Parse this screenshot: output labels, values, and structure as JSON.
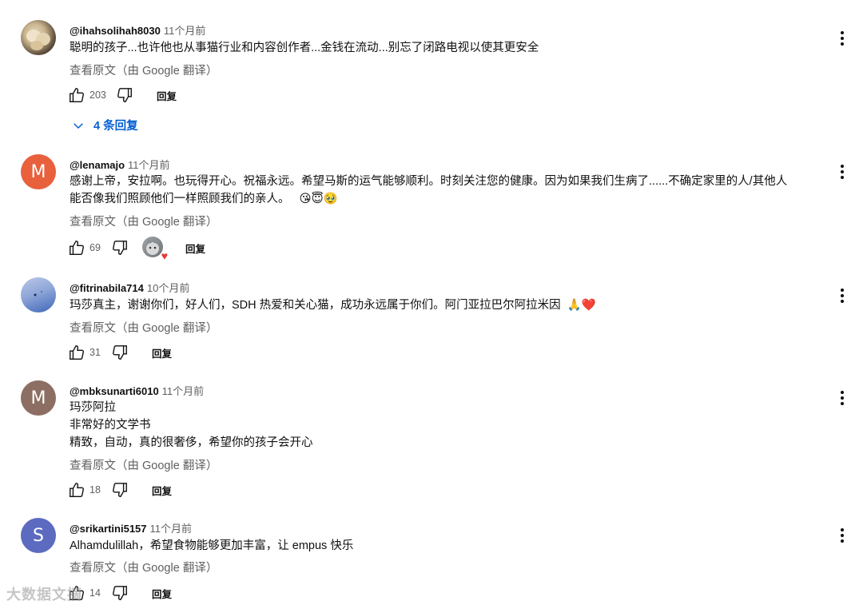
{
  "comments": [
    {
      "author": "@ihahsolihah8030",
      "time": "11个月前",
      "lines": [
        "聪明的孩子...也许他也从事猫行业和内容创作者...金钱在流动...别忘了闭路电视以使其更安全"
      ],
      "translate": "查看原文（由 Google 翻译）",
      "likes": "203",
      "reply_label": "回复",
      "replies_label": "4 条回复"
    },
    {
      "author": "@lenamajo",
      "time": "11个月前",
      "avatar_letter": "M",
      "avatar_color": "#e8603c",
      "lines": [
        "感谢上帝，安拉啊。也玩得开心。祝福永远。希望马斯的运气能够顺利。时刻关注您的健康。因为如果我们生病了......不确定家里的人/其他人",
        "能否像我们照顾他们一样照顾我们的亲人。"
      ],
      "emojis": [
        "😘",
        "😇",
        "🥹"
      ],
      "translate": "查看原文（由 Google 翻译）",
      "likes": "69",
      "reply_label": "回复"
    },
    {
      "author": "@fitrinabila714",
      "time": "10个月前",
      "lines": [
        "玛莎真主，谢谢你们，好人们，SDH 热爱和关心猫，成功永远属于你们。阿门亚拉巴尔阿拉米因"
      ],
      "emojis": [
        "🙏",
        "❤️"
      ],
      "translate": "查看原文（由 Google 翻译）",
      "likes": "31",
      "reply_label": "回复"
    },
    {
      "author": "@mbksunarti6010",
      "time": "11个月前",
      "avatar_letter": "M",
      "avatar_color": "#8d6e63",
      "lines": [
        "玛莎阿拉",
        "非常好的文学书",
        "精致，自动，真的很奢侈，希望你的孩子会开心"
      ],
      "translate": "查看原文（由 Google 翻译）",
      "likes": "18",
      "reply_label": "回复"
    },
    {
      "author": "@srikartini5157",
      "time": "11个月前",
      "avatar_letter": "S",
      "avatar_color": "#5c6bc0",
      "lines": [
        "Alhamdulillah，希望食物能够更加丰富，让 empus 快乐"
      ],
      "translate": "查看原文（由 Google 翻译）",
      "likes": "14",
      "reply_label": "回复"
    }
  ],
  "watermark": "大数据文摘",
  "colors": {
    "link": "#065fd4",
    "secondary": "#606060",
    "heart": "#e53935"
  }
}
